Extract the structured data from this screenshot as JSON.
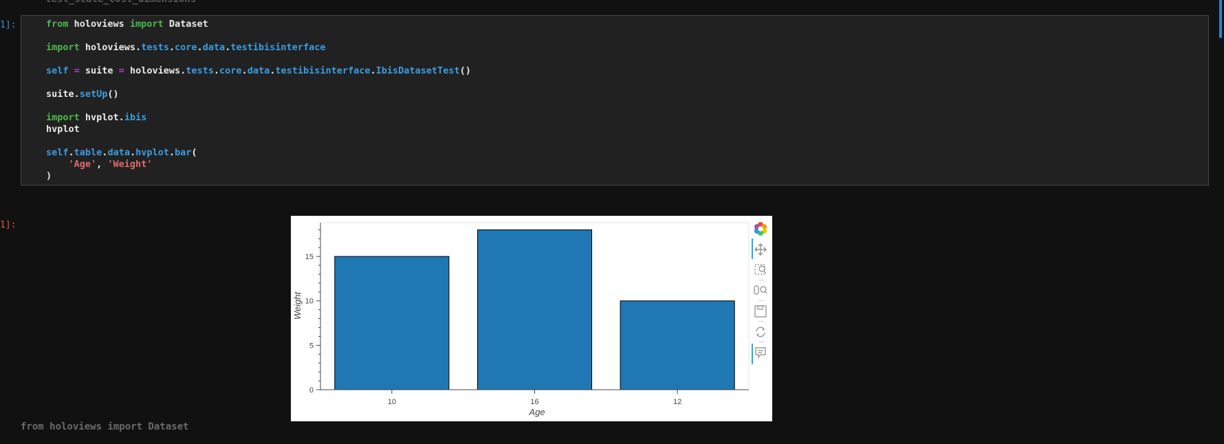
{
  "notebook": {
    "top_clipped_text": "test_scale_cost_dimensions",
    "in_prompt": "1]:",
    "out_prompt": "1]:",
    "bottom_text": "from holoviews import Dataset"
  },
  "code": {
    "l1": {
      "kw1": "from",
      "t1": " holoviews ",
      "kw2": "import",
      "t2": " Dataset"
    },
    "l2": {
      "kw1": "import",
      "t1": " holoviews.",
      "m1": "tests",
      "d1": ".",
      "m2": "core",
      "d2": ".",
      "m3": "data",
      "d3": ".",
      "m4": "testibisinterface"
    },
    "l3": {
      "m0": "self",
      "s1": " ",
      "op1": "=",
      "t1": " suite ",
      "op2": "=",
      "t2": " holoviews.",
      "m1": "tests",
      "d1": ".",
      "m2": "core",
      "d2": ".",
      "m3": "data",
      "d3": ".",
      "m4": "testibisinterface",
      "d4": ".",
      "m5": "IbisDatasetTest",
      "t3": "()"
    },
    "l4": {
      "t1": "suite.",
      "m1": "setUp",
      "t2": "()"
    },
    "l5": {
      "kw1": "import",
      "t1": " hvplot.",
      "m1": "ibis"
    },
    "l6": {
      "t1": "hvplot"
    },
    "l7": {
      "m0": "self",
      "d0": ".",
      "m1": "table",
      "d1": ".",
      "m2": "data",
      "d2": ".",
      "m3": "hvplot",
      "d3": ".",
      "m4": "bar",
      "t1": "("
    },
    "l8": {
      "ind": "    ",
      "s1": "'Age'",
      "t1": ", ",
      "s2": "'Weight'"
    },
    "l9": {
      "t1": ")"
    }
  },
  "chart_data": {
    "type": "bar",
    "categories": [
      "10",
      "16",
      "12"
    ],
    "values": [
      15,
      18,
      10
    ],
    "xlabel": "Age",
    "ylabel": "Weight",
    "ylim": [
      0,
      18.8
    ],
    "yticks": [
      "0",
      "5",
      "10",
      "15"
    ],
    "ytick_values": [
      0,
      5,
      10,
      15
    ],
    "grid": false,
    "bar_color": "#1f77b4"
  },
  "toolbar": {
    "tools": [
      "bokeh-logo-icon",
      "pan-icon",
      "box-zoom-icon",
      "wheel-zoom-icon",
      "save-icon",
      "reset-icon",
      "hover-icon"
    ]
  },
  "colors": {
    "keyword": "#4cb84c",
    "module": "#3b9de2",
    "operator": "#b040d0",
    "string": "#e36a6a",
    "in_prompt": "#3d8fd6",
    "out_prompt": "#e05a3c"
  }
}
